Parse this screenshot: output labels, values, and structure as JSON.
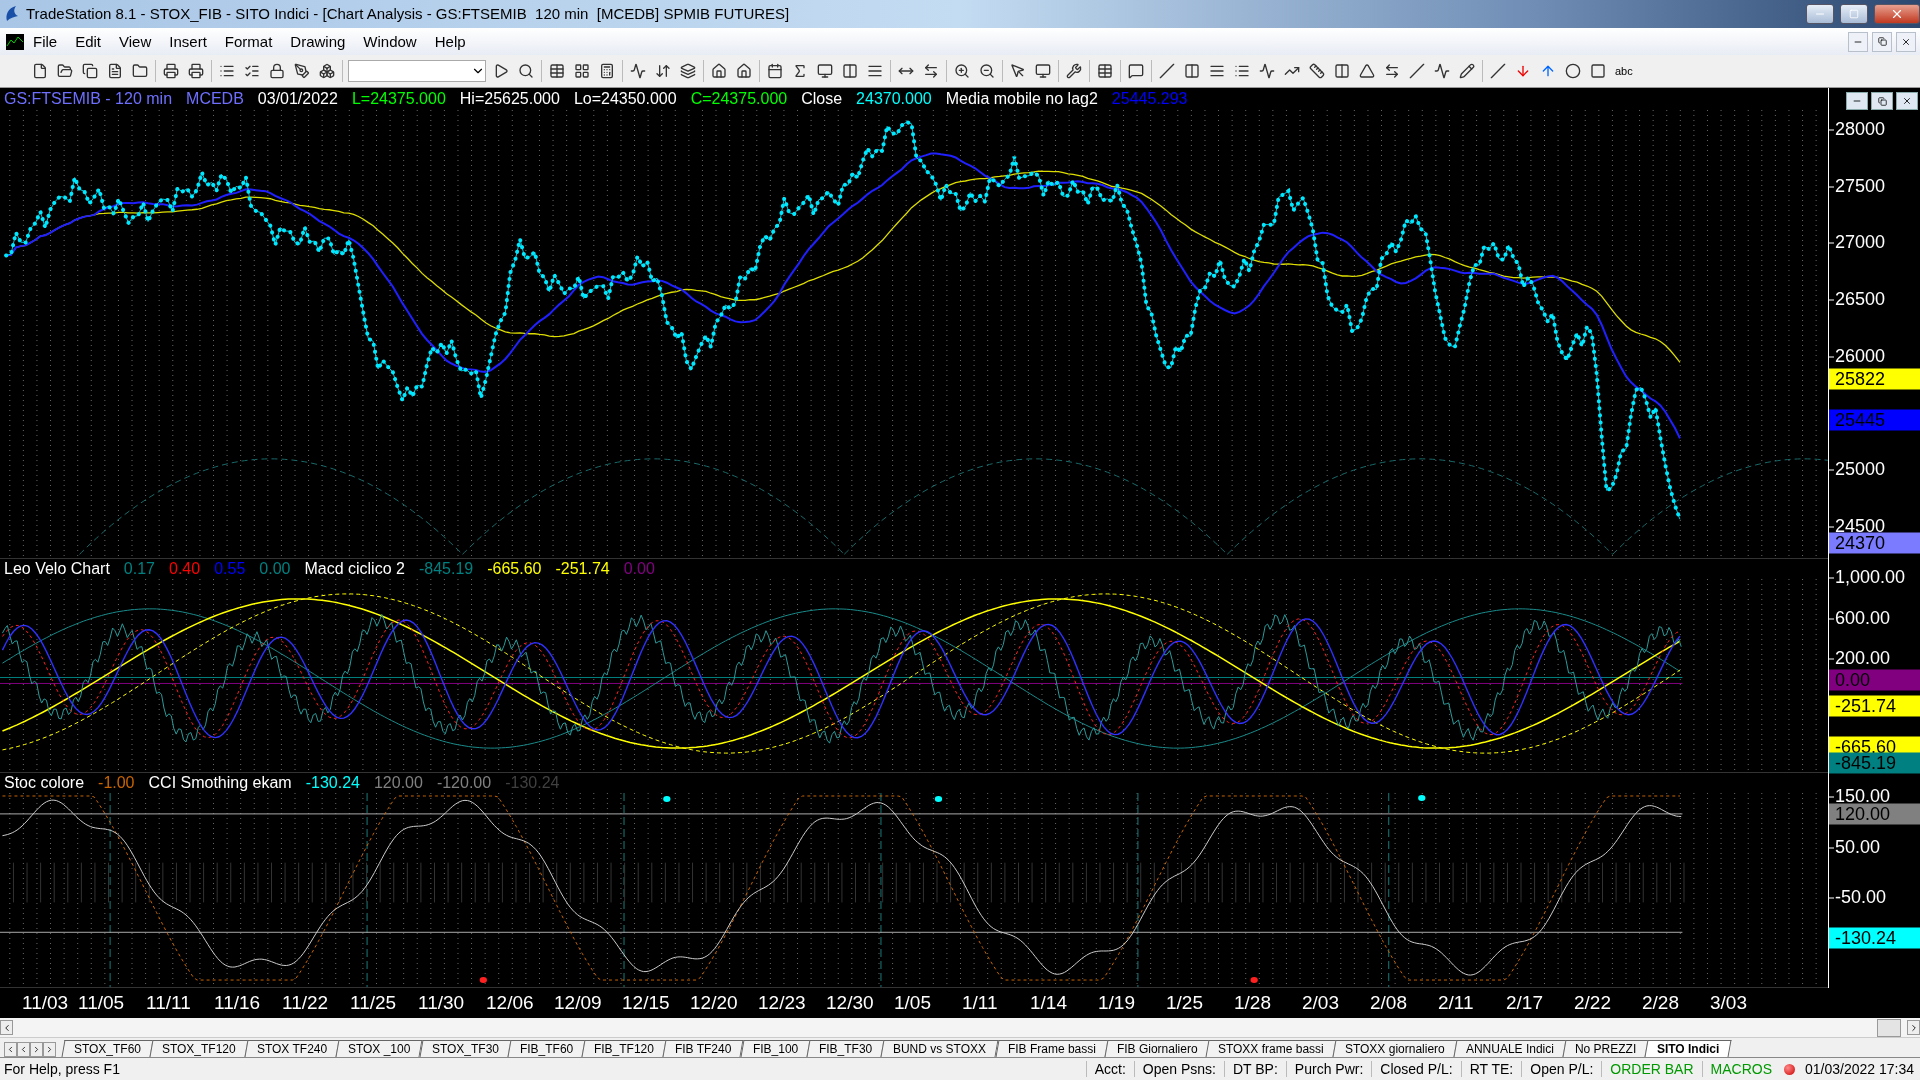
{
  "window": {
    "title": "TradeStation 8.1 - STOX_FIB - SITO Indici - [Chart Analysis - GS:FTSEMIB  120 min  [MCEDB] SPMIB FUTURES]"
  },
  "menu": [
    "File",
    "Edit",
    "View",
    "Insert",
    "Format",
    "Drawing",
    "Window",
    "Help"
  ],
  "toolbar": {
    "text_button": "abc"
  },
  "price_pane": {
    "legend": [
      {
        "text": "GS:FTSEMIB - 120 min",
        "color": "#6f6fff"
      },
      {
        "text": "MCEDB",
        "color": "#6f6fff"
      },
      {
        "text": "03/01/2022",
        "color": "#ffffff"
      },
      {
        "text": "L=24375.000",
        "color": "#00ff00"
      },
      {
        "text": "Hi=25625.000",
        "color": "#ffffff"
      },
      {
        "text": "Lo=24350.000",
        "color": "#ffffff"
      },
      {
        "text": "C=24375.000",
        "color": "#00ff00"
      },
      {
        "text": "Close",
        "color": "#ffffff"
      },
      {
        "text": "24370.000",
        "color": "#00ffff"
      },
      {
        "text": "Media mobile no lag2",
        "color": "#ffffff"
      },
      {
        "text": "25445.293",
        "color": "#0000ff"
      }
    ],
    "ticks": [
      "28000",
      "27500",
      "27000",
      "26500",
      "26000",
      "25000",
      "24500"
    ],
    "badges": [
      {
        "text": "25822",
        "color": "#ffff00"
      },
      {
        "text": "25445",
        "color": "#0000ff"
      },
      {
        "text": "24370",
        "color": "#7b7bff"
      }
    ]
  },
  "oscillator_pane": {
    "legend": [
      {
        "text": "Leo Velo Chart",
        "color": "#ffffff"
      },
      {
        "text": "0.17",
        "color": "#008080"
      },
      {
        "text": "0.40",
        "color": "#ff0000"
      },
      {
        "text": "0.55",
        "color": "#0000ff"
      },
      {
        "text": "0.00",
        "color": "#008080"
      },
      {
        "text": "Macd ciclico 2",
        "color": "#ffffff"
      },
      {
        "text": "-845.19",
        "color": "#008080"
      },
      {
        "text": "-665.60",
        "color": "#ffff00"
      },
      {
        "text": "-251.74",
        "color": "#ffff00"
      },
      {
        "text": "0.00",
        "color": "#800080"
      }
    ],
    "ticks": [
      "1,000.00",
      "600.00",
      "200.00"
    ],
    "badges": [
      {
        "text": "0.00",
        "color": "#800080"
      },
      {
        "text": "-251.74",
        "color": "#ffff00"
      },
      {
        "text": "-665.60",
        "color": "#ffff00"
      },
      {
        "text": "-845.19",
        "color": "#008080"
      }
    ]
  },
  "cci_pane": {
    "legend": [
      {
        "text": "Stoc colore",
        "color": "#ffffff"
      },
      {
        "text": "-1.00",
        "color": "#c86400"
      },
      {
        "text": "CCI Smothing ekam",
        "color": "#ffffff"
      },
      {
        "text": "-130.24",
        "color": "#00ffff"
      },
      {
        "text": "120.00",
        "color": "#808080"
      },
      {
        "text": "-120.00",
        "color": "#808080"
      },
      {
        "text": "-130.24",
        "color": "#404040"
      }
    ],
    "ticks": [
      "150.00",
      "50.00",
      "-50.00"
    ],
    "badges": [
      {
        "text": "120.00",
        "color": "#808080"
      },
      {
        "text": "-130.24",
        "color": "#00ffff"
      }
    ]
  },
  "date_axis": [
    "11/03",
    "11/05",
    "11/11",
    "11/16",
    "11/22",
    "11/25",
    "11/30",
    "12/06",
    "12/09",
    "12/15",
    "12/20",
    "12/23",
    "12/30",
    "1/05",
    "1/11",
    "1/14",
    "1/19",
    "1/25",
    "1/28",
    "2/03",
    "2/08",
    "2/11",
    "2/17",
    "2/22",
    "2/28",
    "3/03"
  ],
  "tabs": [
    {
      "label": "STOX_TF60",
      "selected": false
    },
    {
      "label": "STOX_TF120",
      "selected": false
    },
    {
      "label": "STOX TF240",
      "selected": false
    },
    {
      "label": "STOX _100",
      "selected": false
    },
    {
      "label": "STOX_TF30",
      "selected": false
    },
    {
      "label": "FIB_TF60",
      "selected": false
    },
    {
      "label": "FIB_TF120",
      "selected": false
    },
    {
      "label": "FIB TF240",
      "selected": false
    },
    {
      "label": "FIB_100",
      "selected": false
    },
    {
      "label": "FIB_TF30",
      "selected": false
    },
    {
      "label": "BUND vs STOXX",
      "selected": false
    },
    {
      "label": "FIB Frame bassi",
      "selected": false
    },
    {
      "label": "FIB Giornaliero",
      "selected": false
    },
    {
      "label": "STOXX frame bassi",
      "selected": false
    },
    {
      "label": "STOXX giornaliero",
      "selected": false
    },
    {
      "label": "ANNUALE Indici",
      "selected": false
    },
    {
      "label": "No PREZZI",
      "selected": false
    },
    {
      "label": "SITO Indici",
      "selected": true
    }
  ],
  "status_bar": {
    "help": "For Help, press F1",
    "fields": [
      {
        "text": "Acct:",
        "color": "#000000"
      },
      {
        "text": "Open Psns:",
        "color": "#000000"
      },
      {
        "text": "DT BP:",
        "color": "#000000"
      },
      {
        "text": "Purch Pwr:",
        "color": "#000000"
      },
      {
        "text": "Closed P/L:",
        "color": "#000000"
      },
      {
        "text": "RT TE:",
        "color": "#000000"
      },
      {
        "text": "Open P/L:",
        "color": "#000000"
      },
      {
        "text": "ORDER BAR",
        "color": "#009900"
      },
      {
        "text": "MACROS",
        "color": "#009900"
      }
    ],
    "clock": "01/03/2022 17:34"
  }
}
